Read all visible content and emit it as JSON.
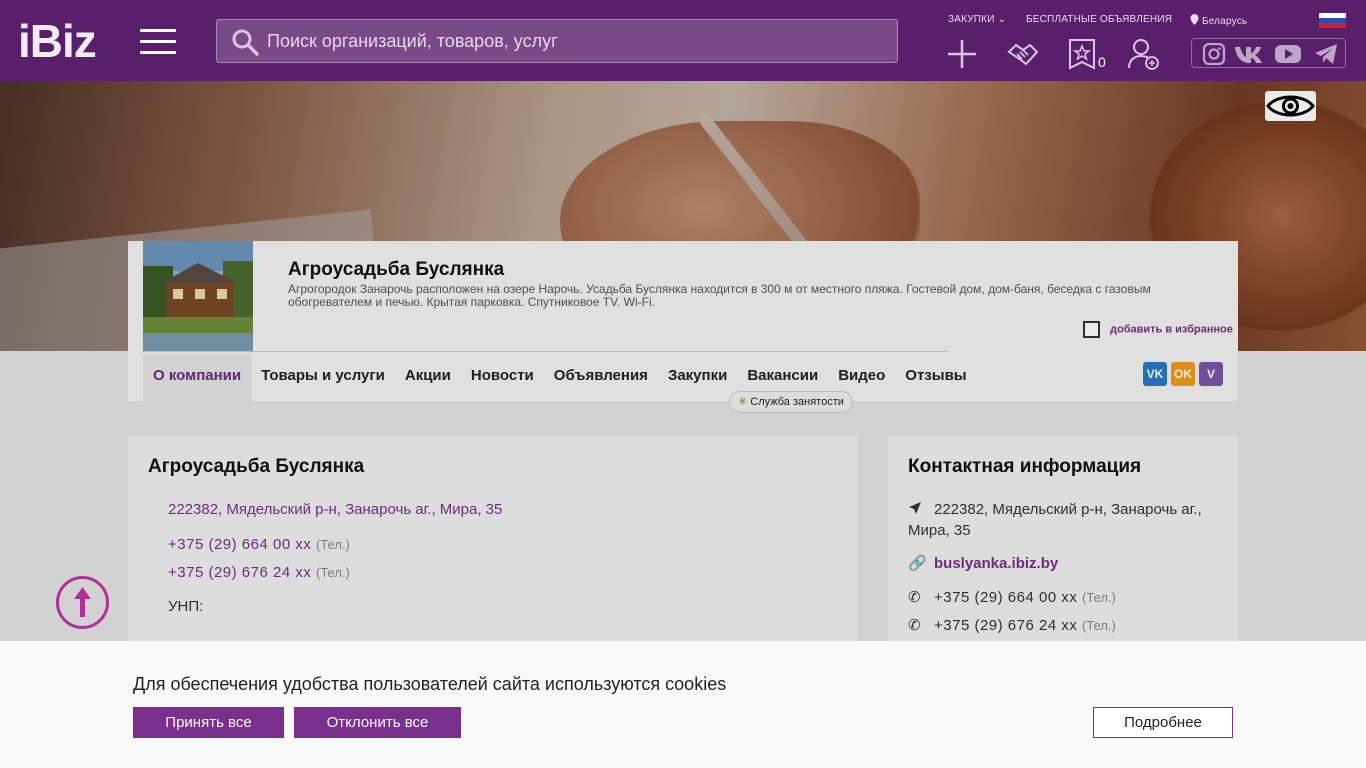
{
  "header": {
    "logo": "iBiz",
    "search_placeholder": "Поиск организаций, товаров, услуг",
    "zakupki": "ЗАКУПКИ",
    "free_ads": "БЕСПЛАТНЫЕ ОБЪЯВЛЕНИЯ",
    "region": "Беларусь",
    "fav_count": "0"
  },
  "company": {
    "name": "Агроусадьба Буслянка",
    "description": "Агрогородок Занарочь расположен на озере Нарочь. Усадьба Буслянка находится в 300 м от местного пляжа. Гостевой дом, дом-баня, беседка с газовым обогревателем и печью. Крытая парковка. Спутниковое TV. Wi-Fi.",
    "add_favorite": "добавить в избранное",
    "tabs": [
      "О компании",
      "Товары и услуги",
      "Акции",
      "Новости",
      "Объявления",
      "Закупки",
      "Вакансии",
      "Видео",
      "Отзывы"
    ],
    "employment_service": "Служба занятости",
    "share": {
      "vk": "VK",
      "ok": "OK",
      "viber": "V"
    }
  },
  "main": {
    "title": "Агроусадьба Буслянка",
    "address": "222382, Мядельский р-н, Занарочь аг., Мира, 35",
    "phones": [
      {
        "number": "+375 (29) 664 00 хх",
        "type": "(Тел.)"
      },
      {
        "number": "+375 (29) 676 24 хх",
        "type": "(Тел.)"
      }
    ],
    "unp": "УНП:"
  },
  "contacts": {
    "title": "Контактная информация",
    "address": "222382, Мядельский р-н, Занарочь аг., Мира, 35",
    "site": "buslyanka.ibiz.by",
    "phones": [
      {
        "number": "+375 (29) 664 00 хх",
        "type": "(Тел.)"
      },
      {
        "number": "+375 (29) 676 24 хх",
        "type": "(Тел.)"
      }
    ]
  },
  "cookie": {
    "message": "Для обеспечения удобства пользователей сайта используются cookies",
    "accept": "Принять все",
    "decline": "Отклонить все",
    "more": "Подробнее"
  },
  "colors": {
    "brand": "#5a1f6b",
    "accent": "#7a2e8e",
    "vk": "#2a79c7",
    "ok": "#f29a1f",
    "viber": "#7a55a6"
  },
  "icons": [
    "search-icon",
    "menu-icon",
    "plus-icon",
    "handshake-icon",
    "star-icon",
    "user-add-icon",
    "instagram-icon",
    "vk-icon",
    "youtube-icon",
    "telegram-icon",
    "eye-icon",
    "location-icon",
    "link-icon",
    "phone-icon",
    "arrow-up-icon"
  ]
}
